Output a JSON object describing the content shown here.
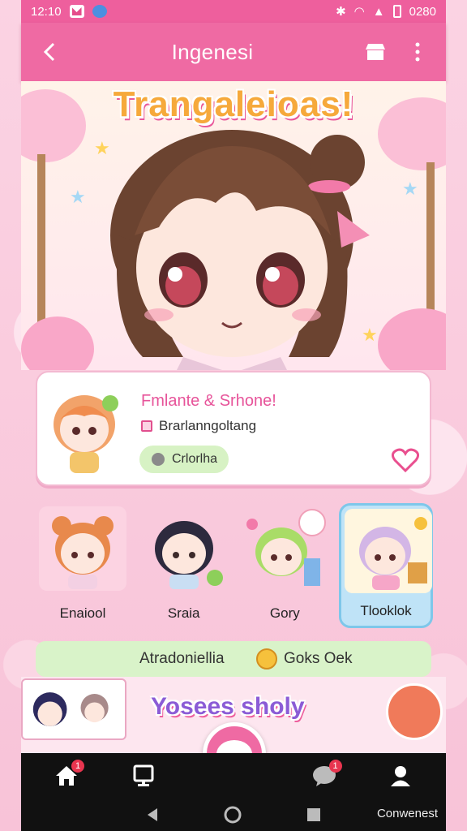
{
  "status_bar": {
    "time": "12:10",
    "right_text": "0280"
  },
  "header": {
    "title": "Ingenesi"
  },
  "hero": {
    "banner_text": "Trangaleioas!"
  },
  "profile": {
    "name": "Fmlante & Srhone!",
    "subtitle": "Brarlanngoltang",
    "tag": "Crlorlha"
  },
  "characters": [
    {
      "label": "Enaiool"
    },
    {
      "label": "Sraia"
    },
    {
      "label": "Gory"
    },
    {
      "label": "Tlooklok"
    }
  ],
  "tags_row": {
    "left": "Atradoniellia",
    "right": "Goks Oek"
  },
  "bottom_banner": "Yosees sholy",
  "nav": {
    "home_badge": "1",
    "chat_badge": "1",
    "system_label": "Conwenest"
  },
  "colors": {
    "primary": "#ef6aa3",
    "accent": "#f6a93b",
    "tag_green": "#d9f3c9"
  }
}
